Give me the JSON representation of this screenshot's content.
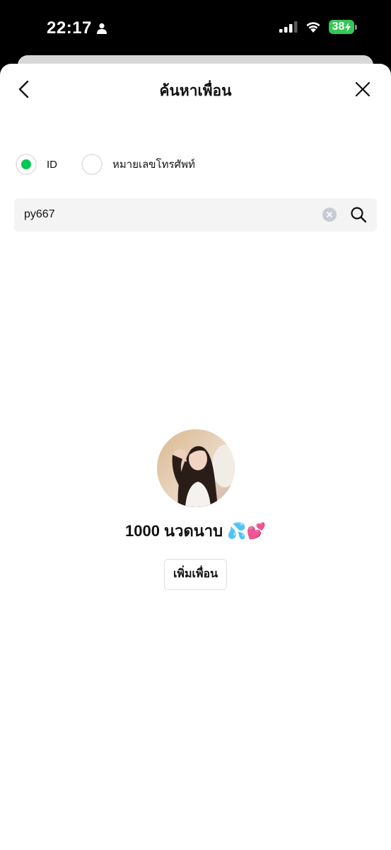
{
  "status_bar": {
    "time": "22:17",
    "battery": "38"
  },
  "header": {
    "title": "ค้นหาเพื่อน"
  },
  "search_type": {
    "options": [
      {
        "label": "ID",
        "selected": true
      },
      {
        "label": "หมายเลขโทรศัพท์",
        "selected": false
      }
    ]
  },
  "search": {
    "value": "py667"
  },
  "result": {
    "name": "1000 นวดนาบ 💦💕",
    "add_button_label": "เพิ่มเพื่อน"
  },
  "colors": {
    "accent_green": "#06c755",
    "battery_green": "#34c759",
    "search_bg": "#f4f4f5"
  }
}
